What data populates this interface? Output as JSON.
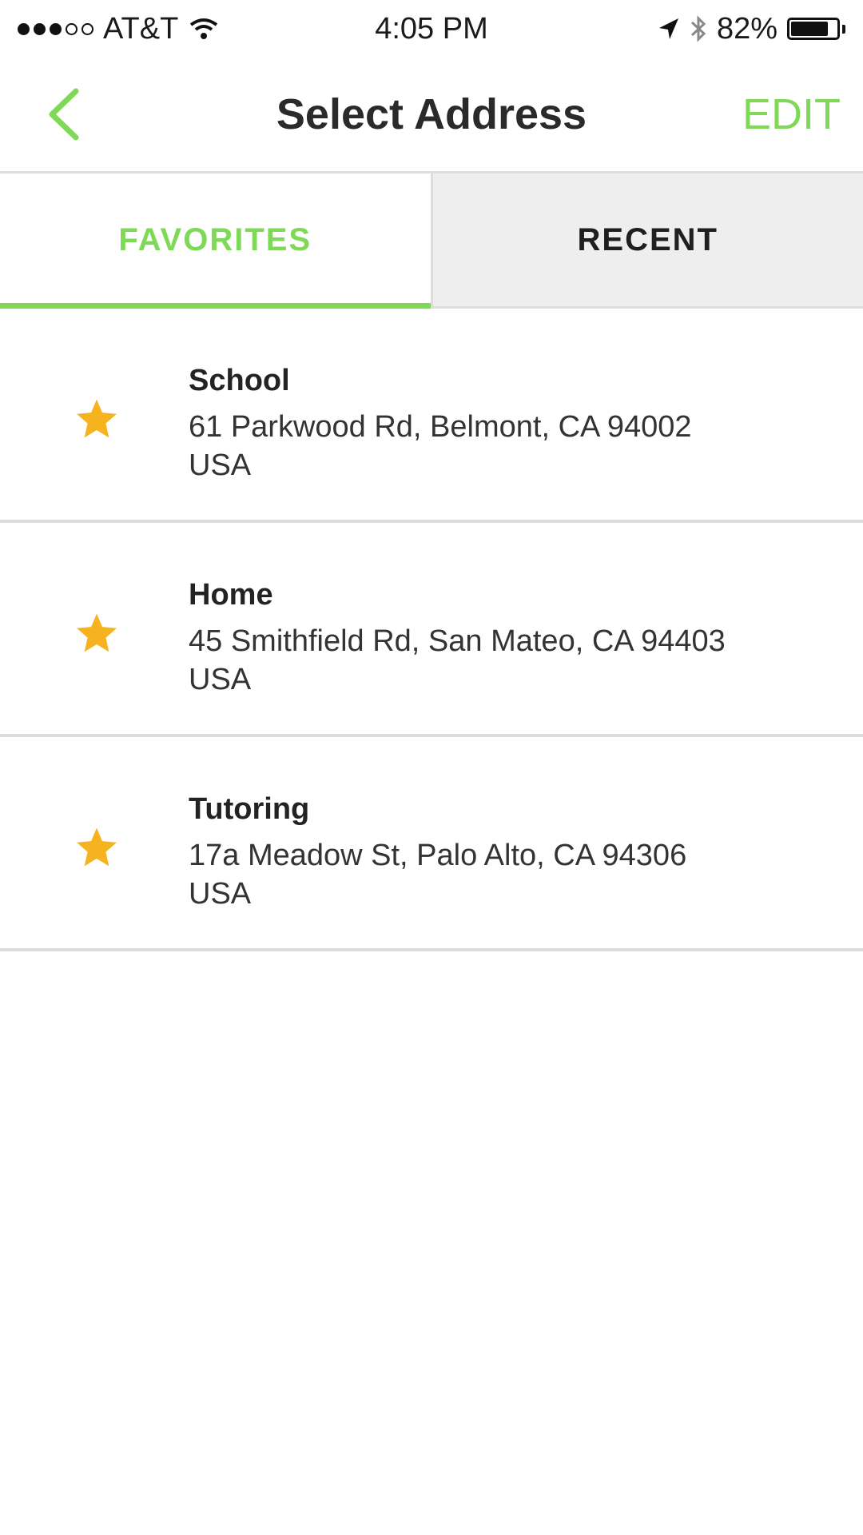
{
  "status_bar": {
    "carrier": "AT&T",
    "time": "4:05 PM",
    "battery_percent": "82%",
    "battery_level": 0.82,
    "icons": [
      "signal-dots",
      "wifi-icon",
      "location-arrow-icon",
      "bluetooth-icon",
      "battery-icon"
    ]
  },
  "nav": {
    "title": "Select Address",
    "edit_label": "EDIT",
    "back_icon": "chevron-left-icon"
  },
  "colors": {
    "accent": "#7ed957",
    "star": "#f5b320",
    "inactive_tab_bg": "#eeeeee"
  },
  "tabs": [
    {
      "label": "FAVORITES",
      "active": true
    },
    {
      "label": "RECENT",
      "active": false
    }
  ],
  "addresses": [
    {
      "name": "School",
      "street": "61 Parkwood Rd, Belmont, CA 94002",
      "country": "USA",
      "icon": "star-icon"
    },
    {
      "name": "Home",
      "street": "45 Smithfield Rd, San Mateo, CA 94403",
      "country": "USA",
      "icon": "star-icon"
    },
    {
      "name": "Tutoring",
      "street": "17a Meadow St, Palo Alto, CA 94306",
      "country": "USA",
      "icon": "star-icon"
    }
  ]
}
